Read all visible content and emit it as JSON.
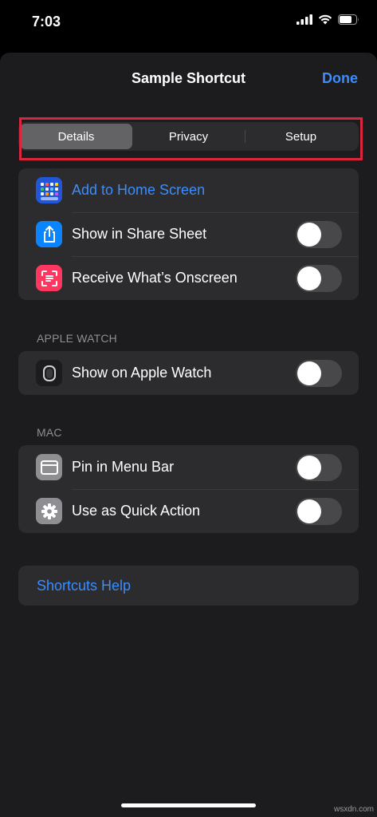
{
  "status_bar": {
    "time": "7:03"
  },
  "nav": {
    "title": "Sample Shortcut",
    "done_label": "Done"
  },
  "tabs": [
    {
      "label": "Details",
      "active": true
    },
    {
      "label": "Privacy",
      "active": false
    },
    {
      "label": "Setup",
      "active": false
    }
  ],
  "main_group": {
    "rows": [
      {
        "label": "Add to Home Screen",
        "icon": "home-screen-icon",
        "is_link": true
      },
      {
        "label": "Show in Share Sheet",
        "icon": "share-icon",
        "toggle_on": false
      },
      {
        "label": "Receive What’s Onscreen",
        "icon": "scan-text-icon",
        "toggle_on": false
      }
    ]
  },
  "apple_watch": {
    "header": "APPLE WATCH",
    "rows": [
      {
        "label": "Show on Apple Watch",
        "icon": "apple-watch-icon",
        "toggle_on": false
      }
    ]
  },
  "mac": {
    "header": "MAC",
    "rows": [
      {
        "label": "Pin in Menu Bar",
        "icon": "menu-bar-icon",
        "toggle_on": false
      },
      {
        "label": "Use as Quick Action",
        "icon": "gear-icon",
        "toggle_on": false
      }
    ]
  },
  "help": {
    "label": "Shortcuts Help"
  },
  "watermark": "wsxdn.com",
  "colors": {
    "accent": "#3a8dff",
    "highlight": "#d7263d",
    "background": "#1c1c1e",
    "cell": "#2c2c2e"
  }
}
